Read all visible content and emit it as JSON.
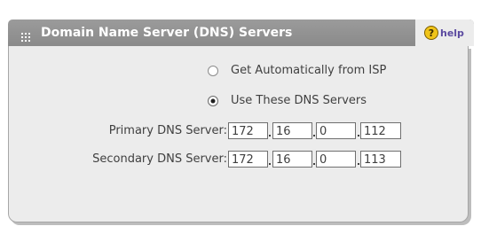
{
  "header": {
    "title": "Domain Name Server (DNS) Servers",
    "help_label": "help",
    "grip_icon": "grip-dots-icon",
    "help_icon": "question-circle-icon",
    "colors": {
      "header_bg": "#8f8f8f",
      "header_text": "#ffffff",
      "help_bg": "#ececec",
      "help_text": "#5b4aa0",
      "help_icon_fill": "#f0c419"
    }
  },
  "options": [
    {
      "label": "Get Automatically from ISP",
      "selected": false
    },
    {
      "label": "Use These DNS Servers",
      "selected": true
    }
  ],
  "fields": {
    "primary": {
      "label": "Primary DNS Server:",
      "octets": [
        "172",
        "16",
        "0",
        "112"
      ]
    },
    "secondary": {
      "label": "Secondary DNS Server:",
      "octets": [
        "172",
        "16",
        "0",
        "113"
      ]
    }
  },
  "colors": {
    "panel_bg": "#ececec",
    "text": "#3f3f3f"
  }
}
